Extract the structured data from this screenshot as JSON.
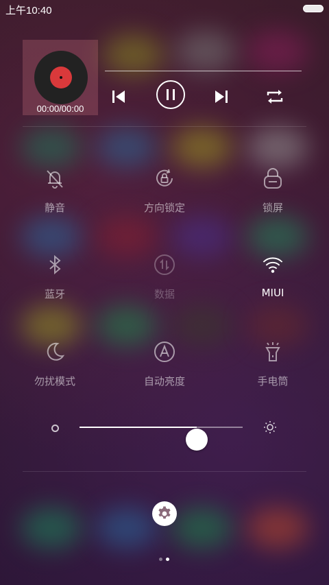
{
  "status_bar": {
    "time": "上午10:40"
  },
  "music": {
    "time_display": "00:00/00:00",
    "progress": 0
  },
  "toggles": [
    {
      "label": "静音",
      "icon": "bell-off-icon",
      "state": "off"
    },
    {
      "label": "方向锁定",
      "icon": "rotation-lock-icon",
      "state": "off"
    },
    {
      "label": "锁屏",
      "icon": "lock-icon",
      "state": "off"
    },
    {
      "label": "蓝牙",
      "icon": "bluetooth-icon",
      "state": "off"
    },
    {
      "label": "数据",
      "icon": "mobile-data-icon",
      "state": "disabled"
    },
    {
      "label": "MIUI",
      "icon": "wifi-icon",
      "state": "on"
    },
    {
      "label": "勿扰模式",
      "icon": "moon-icon",
      "state": "off"
    },
    {
      "label": "自动亮度",
      "icon": "auto-brightness-icon",
      "state": "off"
    },
    {
      "label": "手电筒",
      "icon": "flashlight-icon",
      "state": "off"
    }
  ],
  "brightness": {
    "level": 0.72
  },
  "pager": {
    "page_count": 2,
    "current_page": 2
  },
  "colors": {
    "active": "#ffffff",
    "inactive": "#9a8a98",
    "disc_label": "#d9393b"
  }
}
